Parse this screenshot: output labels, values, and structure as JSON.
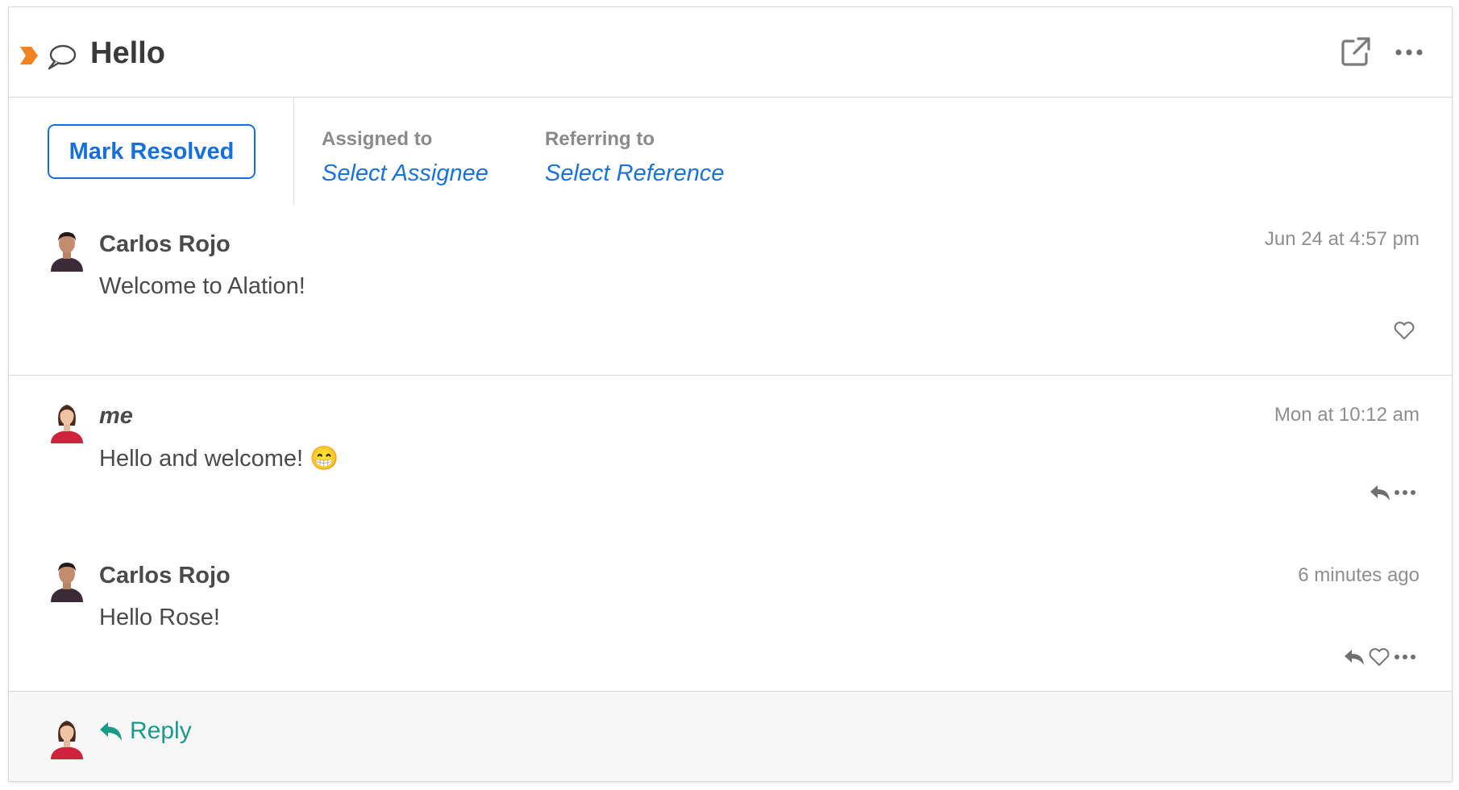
{
  "header": {
    "title": "Hello",
    "flag_icon": "flag-icon",
    "conversation_icon": "speech-bubble-icon",
    "open_icon": "external-link-icon",
    "more_icon": "ellipsis-icon"
  },
  "meta": {
    "mark_resolved_label": "Mark Resolved",
    "assigned_label": "Assigned to",
    "assigned_value": "Select Assignee",
    "referring_label": "Referring to",
    "referring_value": "Select Reference"
  },
  "comments": [
    {
      "author": "Carlos Rojo",
      "time": "Jun 24 at 4:57 pm",
      "text": "Welcome to Alation!",
      "actions": [
        "like-icon"
      ]
    },
    {
      "author": "me",
      "time": "Mon at 10:12 am",
      "text": "Hello and welcome! 😁",
      "actions": [
        "reply-icon",
        "more-icon"
      ]
    },
    {
      "author": "Carlos Rojo",
      "time": "6 minutes ago",
      "text": "Hello Rose!",
      "actions": [
        "reply-icon",
        "like-icon",
        "more-icon"
      ]
    }
  ],
  "footer": {
    "reply_label": "Reply"
  },
  "colors": {
    "accent_blue": "#1570dc",
    "link_blue": "#1a73d9",
    "reply_teal": "#1b9a8a",
    "flag_orange": "#f58220",
    "footer_bg": "#f7f7f7"
  }
}
